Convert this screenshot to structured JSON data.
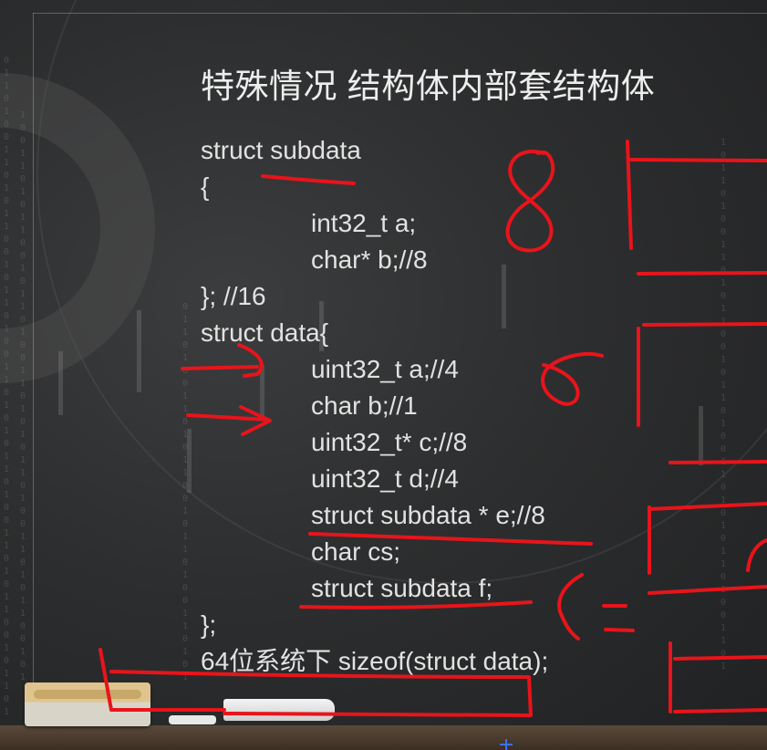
{
  "slide": {
    "title": "特殊情况 结构体内部套结构体",
    "code_lines": [
      {
        "text": "struct subdata",
        "indent": false
      },
      {
        "text": "{",
        "indent": false
      },
      {
        "text": "int32_t a;",
        "indent": true
      },
      {
        "text": "char* b;//8",
        "indent": true
      },
      {
        "text": "}; //16",
        "indent": false
      },
      {
        "text": "struct data{",
        "indent": false
      },
      {
        "text": "uint32_t a;//4",
        "indent": true
      },
      {
        "text": "char b;//1",
        "indent": true
      },
      {
        "text": "uint32_t* c;//8",
        "indent": true
      },
      {
        "text": "uint32_t d;//4",
        "indent": true
      },
      {
        "text": "struct subdata * e;//8",
        "indent": true
      },
      {
        "text": "char cs;",
        "indent": true
      },
      {
        "text": "struct subdata f;",
        "indent": true
      },
      {
        "text": "};",
        "indent": false
      },
      {
        "text": "64位系统下 sizeof(struct data);",
        "indent": false
      }
    ]
  },
  "colors": {
    "ink": "#e8141b",
    "text": "#e2e2e2"
  }
}
